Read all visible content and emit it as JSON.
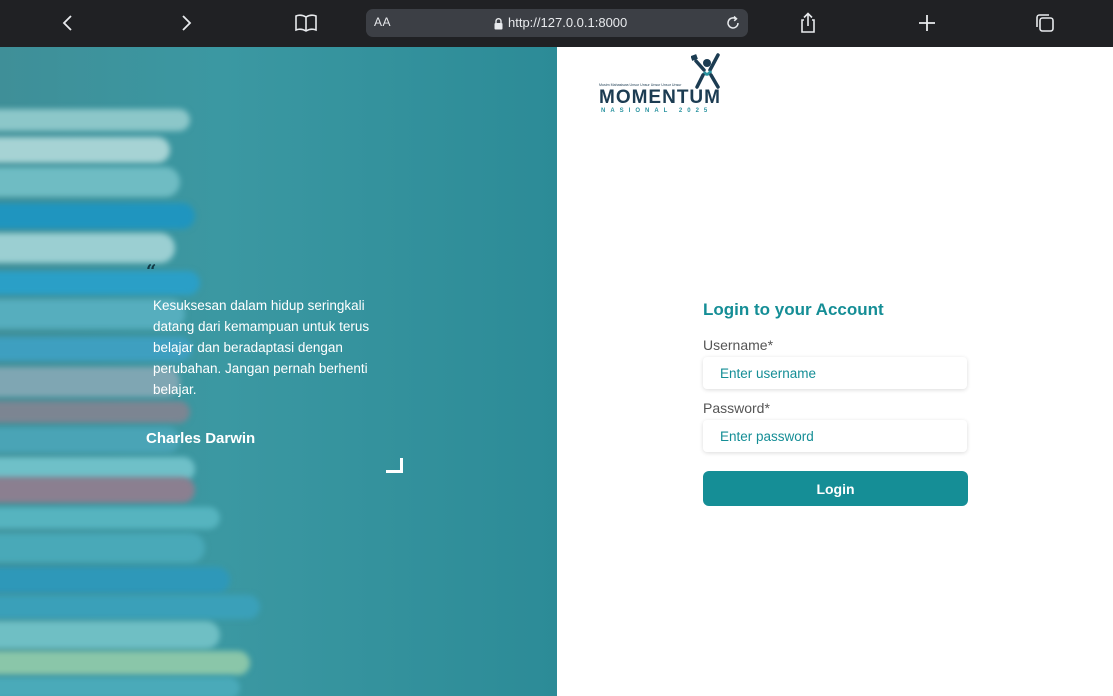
{
  "browser": {
    "url": "http://127.0.0.1:8000",
    "reader_label": "AA",
    "icons": [
      "back-icon",
      "forward-icon",
      "bookmarks-icon",
      "lock-icon",
      "reload-icon",
      "share-icon",
      "new-tab-icon",
      "tabs-icon"
    ]
  },
  "hero": {
    "quote_mark": "“",
    "quote": "Kesuksesan dalam hidup seringkali datang dari kemampuan untuk terus belajar dan beradaptasi dengan perubahan. Jangan pernah berhenti belajar.",
    "author": "Charles Darwin"
  },
  "logo": {
    "tagline": "Musim Mahasiswa Unsur Unsur Unsur Unsur Unsur",
    "word": "MOMENTUM",
    "subtitle": "NASIONAL 2025"
  },
  "login": {
    "title": "Login to your Account",
    "username_label": "Username*",
    "username_placeholder": "Enter username",
    "password_label": "Password*",
    "password_placeholder": "Enter password",
    "button_label": "Login"
  },
  "colors": {
    "accent": "#158e96",
    "toolbar": "#202124",
    "hero": "#3b98a2"
  }
}
